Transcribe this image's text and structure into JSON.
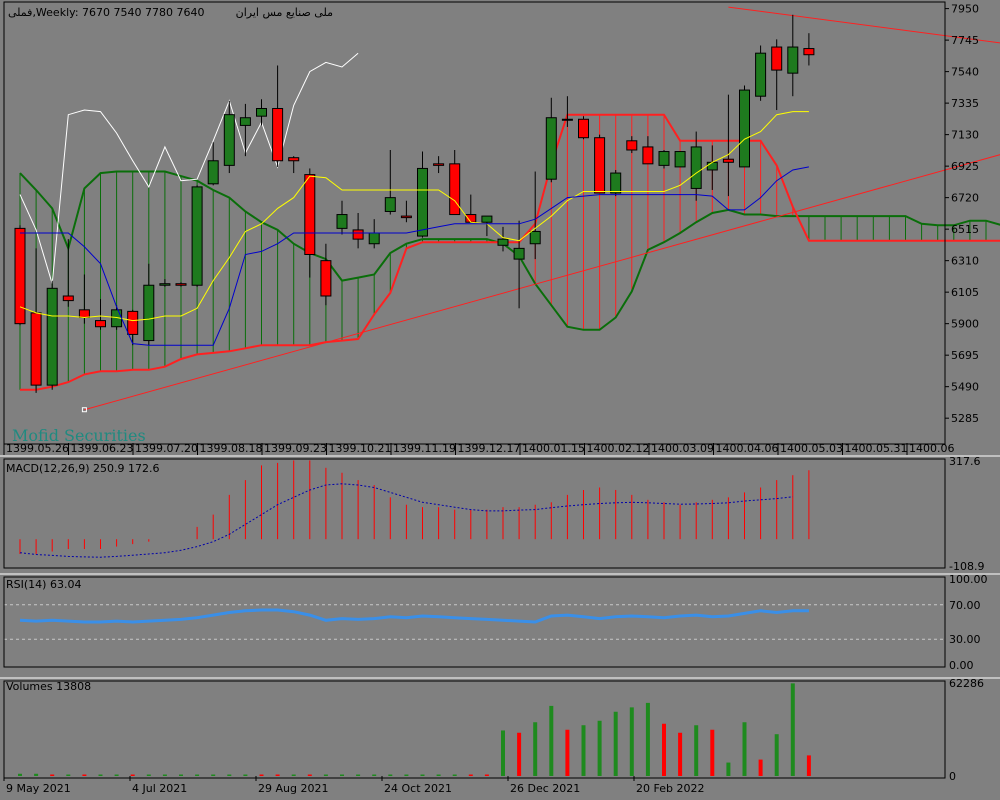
{
  "colors": {
    "background": "#808080",
    "bull": "#1e7a1e",
    "bear": "#ff0000",
    "tenkan": "#ffff00",
    "kijun": "#0000cc",
    "chikou": "#ffffff",
    "spanA": "#0a6e0a",
    "spanB": "#ff2020",
    "trendline": "#ff2020",
    "macd_hist": "#ff0000",
    "macd_signal": "#0000aa",
    "rsi_line": "#3a8fe8",
    "vol_up": "#1e8a1e",
    "vol_down": "#ff0000",
    "watermark": "#1f8a80"
  },
  "chart_data": [
    {
      "type": "candlestick",
      "header": "فملی,Weekly:  7670 7540 7780 7640",
      "symbol_fa": "ملی صنایع مس ایران",
      "watermark": "Mofid Securities",
      "ylim": [
        5130,
        7980
      ],
      "y_ticks": [
        7950,
        7745,
        7540,
        7335,
        7130,
        6925,
        6720,
        6515,
        6310,
        6105,
        5900,
        5695,
        5490,
        5285
      ],
      "x_labels": [
        "1399.05.26",
        "1399.06.23",
        "1399.07.20",
        "1399.08.18",
        "1399.09.23",
        "1399.10.21",
        "1399.11.19",
        "1399.12.17",
        "1400.01.15",
        "1400.02.12",
        "1400.03.09",
        "1400.04.06",
        "1400.05.03",
        "1400.05.31",
        "1400.06"
      ],
      "ohlc": [
        [
          6520,
          6540,
          5890,
          5900
        ],
        [
          5970,
          6390,
          5450,
          5500
        ],
        [
          5500,
          6180,
          5470,
          6130
        ],
        [
          6080,
          6450,
          6010,
          6050
        ],
        [
          5990,
          6220,
          5900,
          5940
        ],
        [
          5920,
          6060,
          5860,
          5880
        ],
        [
          5880,
          6020,
          5860,
          5990
        ],
        [
          5980,
          5990,
          5760,
          5830
        ],
        [
          5790,
          6290,
          5760,
          6150
        ],
        [
          6150,
          6190,
          6140,
          6160
        ],
        [
          6160,
          6170,
          6140,
          6150
        ],
        [
          6150,
          6800,
          6140,
          6790
        ],
        [
          6810,
          7080,
          6800,
          6960
        ],
        [
          6930,
          7350,
          6880,
          7260
        ],
        [
          7190,
          7330,
          6990,
          7240
        ],
        [
          7250,
          7360,
          7190,
          7300
        ],
        [
          7300,
          7580,
          6920,
          6960
        ],
        [
          6980,
          6990,
          6880,
          6960
        ],
        [
          6870,
          6910,
          6200,
          6350
        ],
        [
          6310,
          6420,
          6020,
          6080
        ],
        [
          6520,
          6700,
          6480,
          6610
        ],
        [
          6510,
          6620,
          6390,
          6450
        ],
        [
          6420,
          6580,
          6390,
          6490
        ],
        [
          6630,
          7030,
          6610,
          6720
        ],
        [
          6600,
          6700,
          6560,
          6590
        ],
        [
          6470,
          7020,
          6460,
          6910
        ],
        [
          6940,
          6990,
          6880,
          6930
        ],
        [
          6940,
          7030,
          6690,
          6610
        ],
        [
          6610,
          6740,
          6580,
          6560
        ],
        [
          6560,
          6590,
          6470,
          6600
        ],
        [
          6410,
          6530,
          6370,
          6450
        ],
        [
          6320,
          6570,
          6000,
          6390
        ],
        [
          6420,
          6890,
          6320,
          6500
        ],
        [
          6840,
          7370,
          6820,
          7240
        ],
        [
          7230,
          7380,
          7180,
          7230
        ],
        [
          7230,
          7250,
          7100,
          7110
        ],
        [
          7110,
          7130,
          6920,
          6750
        ],
        [
          6750,
          6900,
          6730,
          6880
        ],
        [
          7090,
          7120,
          7010,
          7030
        ],
        [
          7050,
          7120,
          6940,
          6940
        ],
        [
          6930,
          7030,
          6910,
          7020
        ],
        [
          6920,
          6980,
          6920,
          7020
        ],
        [
          6780,
          7150,
          6700,
          7050
        ],
        [
          6900,
          7060,
          6770,
          6950
        ],
        [
          6970,
          7390,
          6730,
          6950
        ],
        [
          6920,
          7450,
          6920,
          7420
        ],
        [
          7380,
          7710,
          7350,
          7660
        ],
        [
          7700,
          7750,
          7290,
          7550
        ],
        [
          7530,
          7910,
          7380,
          7700
        ],
        [
          7690,
          7790,
          7580,
          7650
        ]
      ],
      "tenkan_sen": [
        6010,
        5970,
        5950,
        5950,
        5940,
        5950,
        5940,
        5920,
        5930,
        5950,
        5950,
        6000,
        6180,
        6330,
        6500,
        6550,
        6650,
        6720,
        6860,
        6850,
        6770,
        6770,
        6770,
        6770,
        6770,
        6770,
        6770,
        6700,
        6560,
        6550,
        6460,
        6440,
        6520,
        6600,
        6700,
        6760,
        6760,
        6760,
        6760,
        6760,
        6760,
        6800,
        6880,
        6950,
        7000,
        7100,
        7150,
        7260,
        7280,
        7280
      ],
      "kijun_sen": [
        6490,
        6490,
        6490,
        6490,
        6400,
        6290,
        6010,
        5770,
        5760,
        5760,
        5760,
        5760,
        5760,
        6000,
        6350,
        6370,
        6420,
        6490,
        6490,
        6490,
        6490,
        6490,
        6490,
        6490,
        6490,
        6510,
        6530,
        6550,
        6550,
        6550,
        6550,
        6550,
        6580,
        6650,
        6720,
        6730,
        6740,
        6740,
        6740,
        6740,
        6740,
        6740,
        6740,
        6730,
        6640,
        6640,
        6720,
        6830,
        6900,
        6920
      ],
      "chikou_span": [
        6740,
        6510,
        6160,
        7260,
        7290,
        7280,
        7140,
        6960,
        6790,
        7050,
        6830,
        6840,
        7090,
        7350,
        7010,
        7210,
        6920,
        7320,
        7540,
        7600,
        7570,
        7660
      ],
      "senkou_span_a": [
        6880,
        6770,
        6650,
        6390,
        6780,
        6880,
        6890,
        6890,
        6890,
        6890,
        6860,
        6830,
        6770,
        6720,
        6630,
        6560,
        6510,
        6420,
        6360,
        6320,
        6180,
        6200,
        6220,
        6360,
        6420,
        6450,
        6450,
        6450,
        6450,
        6450,
        6420,
        6340,
        6160,
        6020,
        5880,
        5860,
        5860,
        5940,
        6110,
        6380,
        6430,
        6490,
        6560,
        6620,
        6640,
        6610,
        6610,
        6600,
        6600,
        6600,
        6600,
        6600,
        6600,
        6600,
        6600,
        6600,
        6550,
        6540,
        6540,
        6570,
        6570,
        6540,
        6540,
        6700
      ],
      "senkou_span_b": [
        5470,
        5470,
        5490,
        5520,
        5570,
        5590,
        5590,
        5600,
        5600,
        5620,
        5670,
        5700,
        5710,
        5720,
        5740,
        5760,
        5760,
        5760,
        5760,
        5780,
        5790,
        5800,
        5960,
        6100,
        6390,
        6430,
        6430,
        6430,
        6430,
        6430,
        6430,
        6430,
        6550,
        6940,
        7260,
        7260,
        7260,
        7260,
        7260,
        7260,
        7260,
        7090,
        7090,
        7090,
        7090,
        7090,
        7090,
        6930,
        6660,
        6440,
        6440,
        6440,
        6440,
        6440,
        6440,
        6440,
        6440,
        6440,
        6440,
        6440,
        6440,
        6440,
        6430,
        6320,
        6320,
        6080
      ],
      "trendlines": [
        {
          "from": [
            4,
            5340
          ],
          "to": [
            65,
            7120
          ]
        },
        {
          "from": [
            44,
            7960
          ],
          "to": [
            65,
            7670
          ]
        }
      ]
    },
    {
      "type": "bar",
      "label": "MACD(12,26,9) 250.9 172.6",
      "ylim": [
        -108.9,
        317.6
      ],
      "y_ticks": [
        317.6,
        -108.9
      ],
      "histogram": [
        -60,
        -60,
        -50,
        -40,
        -40,
        -40,
        -30,
        -20,
        -10,
        0,
        0,
        50,
        100,
        180,
        240,
        300,
        310,
        320,
        320,
        290,
        270,
        240,
        220,
        170,
        140,
        130,
        130,
        120,
        120,
        120,
        130,
        130,
        140,
        150,
        180,
        200,
        210,
        200,
        180,
        160,
        150,
        140,
        150,
        160,
        170,
        190,
        210,
        240,
        260,
        280
      ],
      "signal": [
        -55,
        -62,
        -66,
        -70,
        -72,
        -73,
        -70,
        -65,
        -60,
        -55,
        -45,
        -30,
        -10,
        20,
        60,
        100,
        140,
        170,
        200,
        220,
        225,
        220,
        210,
        190,
        170,
        150,
        140,
        130,
        120,
        115,
        115,
        118,
        120,
        128,
        135,
        140,
        145,
        148,
        150,
        148,
        145,
        142,
        143,
        145,
        148,
        155,
        160,
        165,
        172
      ]
    },
    {
      "type": "line",
      "label": "RSI(14) 63.04",
      "ylim": [
        0,
        100
      ],
      "y_ticks": [
        100.0,
        70.0,
        30.0,
        0.0
      ],
      "values": [
        52,
        51,
        52,
        51,
        50,
        50,
        51,
        50,
        51,
        52,
        53,
        55,
        58,
        61,
        63,
        64,
        64,
        62,
        58,
        52,
        54,
        53,
        54,
        56,
        55,
        57,
        56,
        55,
        54,
        53,
        52,
        51,
        50,
        57,
        58,
        56,
        54,
        56,
        57,
        56,
        55,
        57,
        58,
        56,
        57,
        60,
        63,
        61,
        63,
        63
      ]
    },
    {
      "type": "bar",
      "label": "Volumes 13808",
      "ylim": [
        0,
        62286
      ],
      "y_ticks": [
        62286,
        0
      ],
      "values": [
        1500,
        1500,
        1000,
        1000,
        1000,
        1000,
        1000,
        1000,
        1000,
        1000,
        1000,
        1000,
        1000,
        1000,
        1000,
        1000,
        1000,
        1000,
        1000,
        1000,
        1000,
        1000,
        1000,
        1000,
        1000,
        1000,
        1000,
        1000,
        1000,
        1000,
        30500,
        29000,
        36000,
        47000,
        31000,
        34000,
        37000,
        43000,
        46000,
        49000,
        35000,
        29000,
        34000,
        31000,
        9000,
        36000,
        11000,
        28000,
        62000,
        13808
      ],
      "up": [
        true,
        true,
        false,
        true,
        false,
        true,
        true,
        false,
        true,
        true,
        true,
        true,
        true,
        true,
        true,
        false,
        false,
        true,
        false,
        true,
        true,
        true,
        true,
        true,
        true,
        true,
        true,
        true,
        false,
        false,
        true,
        false,
        true,
        true,
        false,
        true,
        true,
        true,
        true,
        true,
        false,
        false,
        true,
        false,
        true,
        true,
        false,
        true,
        true,
        false
      ]
    }
  ],
  "date_axis": {
    "labels": [
      "9 May 2021",
      "4 Jul 2021",
      "29 Aug 2021",
      "24 Oct 2021",
      "26 Dec 2021",
      "20 Feb 2022"
    ]
  }
}
